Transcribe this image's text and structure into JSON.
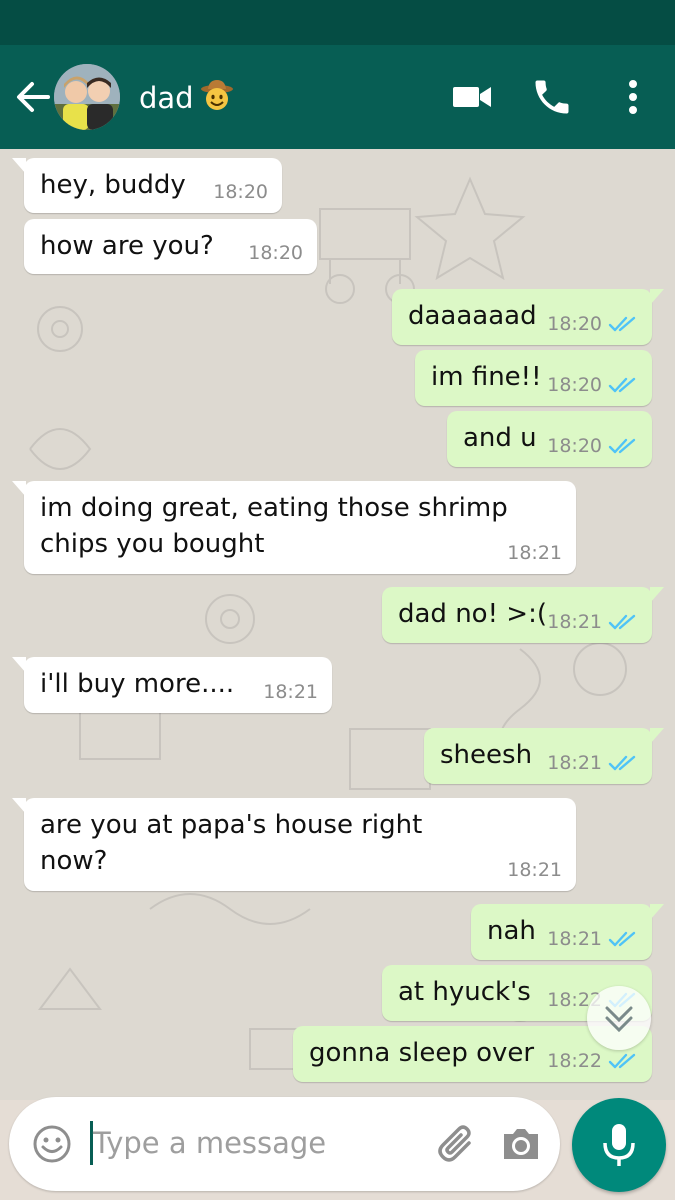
{
  "contact": {
    "name": "dad",
    "name_emoji": "🤠"
  },
  "icons": {
    "back": "arrow-left-icon",
    "video": "video-camera-icon",
    "call": "phone-icon",
    "menu": "more-vertical-icon",
    "emoji": "smiley-icon",
    "attach": "paperclip-icon",
    "camera": "camera-icon",
    "mic": "microphone-icon",
    "scroll": "chevron-double-down-icon"
  },
  "colors": {
    "header": "#075e54",
    "statusbar": "#054d44",
    "outgoing_bubble": "#dcf8c6",
    "incoming_bubble": "#ffffff",
    "read_ticks": "#4fc3f7",
    "fab": "#00897b"
  },
  "messages": [
    {
      "dir": "in",
      "lines": [
        "hey, buddy"
      ],
      "time": "18:20"
    },
    {
      "dir": "in",
      "lines": [
        "how are you?"
      ],
      "time": "18:20"
    },
    {
      "dir": "out",
      "lines": [
        "daaaaaad"
      ],
      "time": "18:20",
      "read": true
    },
    {
      "dir": "out",
      "lines": [
        "im fine!!"
      ],
      "time": "18:20",
      "read": true
    },
    {
      "dir": "out",
      "lines": [
        "and u"
      ],
      "time": "18:20",
      "read": true
    },
    {
      "dir": "in",
      "lines": [
        "im doing great, eating those shrimp",
        "chips you bought"
      ],
      "time": "18:21"
    },
    {
      "dir": "out",
      "lines": [
        "dad no! >:("
      ],
      "time": "18:21",
      "read": true
    },
    {
      "dir": "in",
      "lines": [
        "i'll buy more...."
      ],
      "time": "18:21"
    },
    {
      "dir": "out",
      "lines": [
        "sheesh"
      ],
      "time": "18:21",
      "read": true
    },
    {
      "dir": "in",
      "lines": [
        "are you at papa's house right",
        "now?"
      ],
      "time": "18:21"
    },
    {
      "dir": "out",
      "lines": [
        "nah"
      ],
      "time": "18:21",
      "read": true
    },
    {
      "dir": "out",
      "lines": [
        "at hyuck's"
      ],
      "time": "18:22",
      "read": true
    },
    {
      "dir": "out",
      "lines": [
        "gonna sleep over"
      ],
      "time": "18:22",
      "read": true
    }
  ],
  "composer": {
    "placeholder": "Type a message"
  }
}
